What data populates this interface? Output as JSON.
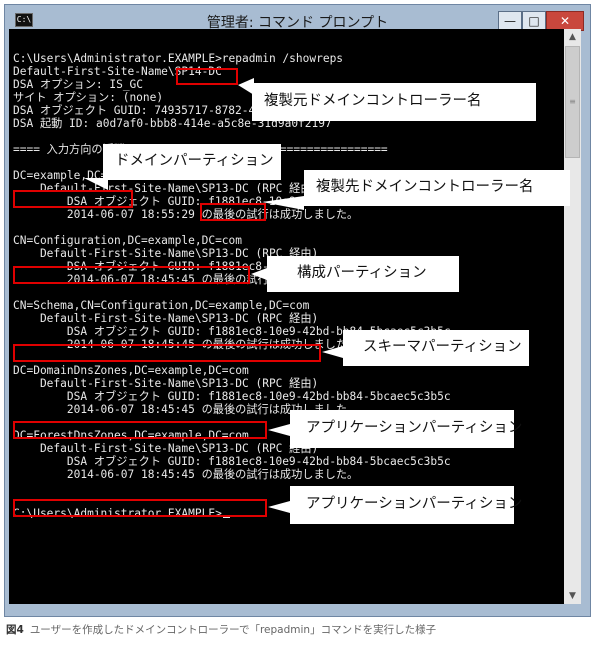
{
  "window": {
    "title": "管理者: コマンド プロンプト",
    "icon_text": "C:\\",
    "buttons": {
      "minimize": "—",
      "maximize": "□",
      "close": "✕"
    }
  },
  "console": {
    "lines": [
      "C:\\Users\\Administrator.EXAMPLE>repadmin /showreps",
      "Default-First-Site-Name\\SP14-DC",
      "DSA オプション: IS_GC",
      "サイト オプション: (none)",
      "DSA オブジェクト GUID: 74935717-8782-4a1c-a9ff-a9494adef92a",
      "DSA 起動 ID: a0d7af0-bbb8-414e-a5c8e-31d9a0f2197",
      "",
      "==== 入力方向の近隣 ======================================",
      "",
      "DC=example,DC=com",
      "    Default-First-Site-Name\\SP13-DC (RPC 経由)",
      "        DSA オブジェクト GUID: f1881ec8-10e9-42bd-bb84-5bcaec5c3b5c",
      "        2014-06-07 18:55:29 の最後の試行は成功しました。",
      "",
      "CN=Configuration,DC=example,DC=com",
      "    Default-First-Site-Name\\SP13-DC (RPC 経由)",
      "        DSA オブジェクト GUID: f1881ec8-10e9-42bd-bb84-5bcaec5c3b5c",
      "        2014-06-07 18:45:45 の最後の試行は成功しました。",
      "",
      "CN=Schema,CN=Configuration,DC=example,DC=com",
      "    Default-First-Site-Name\\SP13-DC (RPC 経由)",
      "        DSA オブジェクト GUID: f1881ec8-10e9-42bd-bb84-5bcaec5c3b5c",
      "        2014-06-07 18:45:45 の最後の試行は成功しました。",
      "",
      "DC=DomainDnsZones,DC=example,DC=com",
      "    Default-First-Site-Name\\SP13-DC (RPC 経由)",
      "        DSA オブジェクト GUID: f1881ec8-10e9-42bd-bb84-5bcaec5c3b5c",
      "        2014-06-07 18:45:45 の最後の試行は成功しました。",
      "",
      "DC=ForestDnsZones,DC=example,DC=com",
      "    Default-First-Site-Name\\SP13-DC (RPC 経由)",
      "        DSA オブジェクト GUID: f1881ec8-10e9-42bd-bb84-5bcaec5c3b5c",
      "        2014-06-07 18:45:45 の最後の試行は成功しました。",
      "",
      "",
      "C:\\Users\\Administrator.EXAMPLE>"
    ]
  },
  "callouts": {
    "source_dc": "複製元ドメインコントローラー名",
    "domain_partition": "ドメインパーティション",
    "dest_dc": "複製先ドメインコントローラー名",
    "config_partition": "構成パーティション",
    "schema_partition": "スキーマパーティション",
    "app_partition_1": "アプリケーションパーティション",
    "app_partition_2": "アプリケーションパーティション"
  },
  "caption": {
    "label": "図4",
    "text": "ユーザーを作成したドメインコントローラーで「repadmin」コマンドを実行した様子"
  },
  "colors": {
    "highlight": "#e00000",
    "console_bg": "#000000",
    "console_text": "#e8e8e8"
  }
}
